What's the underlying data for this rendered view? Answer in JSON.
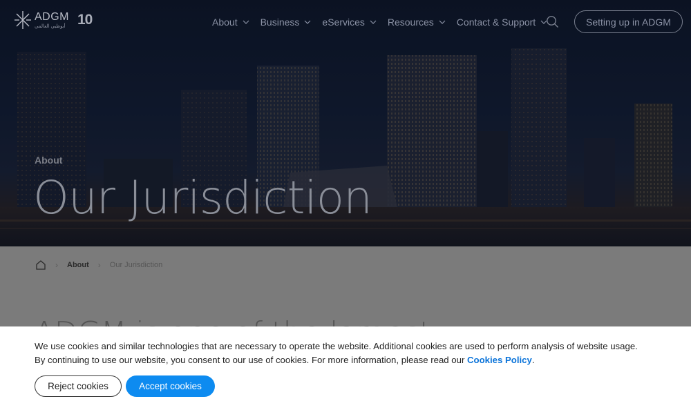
{
  "header": {
    "logo_text": "ADGM",
    "logo_arabic": "أبوظبي العالمي",
    "logo_badge": "10",
    "nav": [
      {
        "label": "About"
      },
      {
        "label": "Business"
      },
      {
        "label": "eServices"
      },
      {
        "label": "Resources"
      },
      {
        "label": "Contact & Support"
      }
    ],
    "cta_label": "Setting up in ADGM"
  },
  "hero": {
    "eyebrow": "About",
    "title": "Our Jurisdiction"
  },
  "breadcrumb": {
    "items": [
      "About",
      "Our Jurisdiction"
    ]
  },
  "content": {
    "heading_partial": "ADGM is one of the largest"
  },
  "cookie_banner": {
    "text_line1": "We use cookies and similar technologies that are necessary to operate the website. Additional cookies are used to perform analysis of website usage.",
    "text_line2_prefix": "By continuing to use our website, you consent to our use of cookies. For more information, please read our ",
    "policy_link": "Cookies Policy",
    "text_line2_suffix": ".",
    "reject_label": "Reject cookies",
    "accept_label": "Accept cookies",
    "accent_color": "#0d8bf0"
  }
}
